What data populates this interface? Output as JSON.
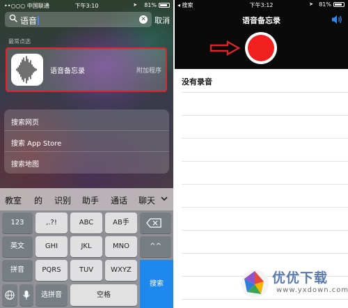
{
  "left": {
    "status_bar": {
      "carrier": "••○○○ 中国联通",
      "network": "4G",
      "time": "下午3:10",
      "battery": "81%"
    },
    "search": {
      "query": "语音",
      "cancel_label": "取消"
    },
    "section_title": "最常点选",
    "top_hit": {
      "app_name": "语音备忘录",
      "tag": "附加程序"
    },
    "web_results": [
      "搜索网页",
      "搜索 App Store",
      "搜索地图"
    ],
    "candidates": [
      "教室",
      "的",
      "识别",
      "助手",
      "通话",
      "聊天"
    ],
    "keyboard": {
      "row1": [
        "123",
        ",.?!",
        "ABC",
        "AB手"
      ],
      "row2": [
        "英文",
        "GHI",
        "JKL",
        "MNO",
        "^^"
      ],
      "row3": [
        "拼音",
        "PQRS",
        "TUV",
        "WXYZ"
      ],
      "bottom": [
        "选拼音",
        "空格"
      ],
      "search_key": "搜索"
    }
  },
  "right": {
    "status_bar": {
      "back": "◂ 搜索",
      "time": "下午3:12",
      "battery": "81%"
    },
    "title": "语音备忘录",
    "empty_message": "没有录音"
  },
  "watermark": {
    "brand": "优优下载",
    "url": "www.yxdown.com"
  },
  "colors": {
    "highlight": "#e0242a",
    "record": "#f0201f",
    "search_key": "#1f88ef"
  }
}
